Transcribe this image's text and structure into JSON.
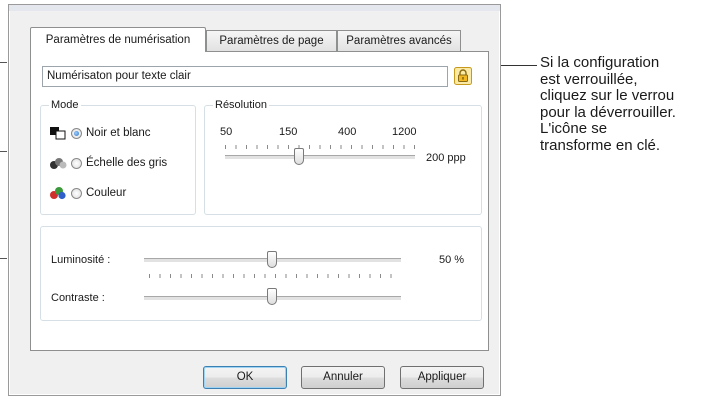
{
  "tabs": [
    {
      "label": "Paramètres de numérisation",
      "active": true
    },
    {
      "label": "Paramètres de page",
      "active": false
    },
    {
      "label": "Paramètres avancés",
      "active": false
    }
  ],
  "configuration": {
    "name_value": "Numérisaton pour texte clair",
    "lock_icon": "lock-icon"
  },
  "mode": {
    "title": "Mode",
    "options": [
      {
        "label": "Noir et blanc",
        "checked": true,
        "icon": "black-white-mode-icon"
      },
      {
        "label": "Échelle des gris",
        "checked": false,
        "icon": "grayscale-mode-icon"
      },
      {
        "label": "Couleur",
        "checked": false,
        "icon": "color-mode-icon"
      }
    ]
  },
  "resolution": {
    "title": "Résolution",
    "ticks": [
      "50",
      "150",
      "400",
      "1200"
    ],
    "value": 200,
    "value_label": "200 ppp"
  },
  "adjustments": {
    "brightness": {
      "label": "Luminosité :",
      "value": 50,
      "value_label": "50 %"
    },
    "contrast": {
      "label": "Contraste :",
      "value": 50
    }
  },
  "buttons": {
    "ok": "OK",
    "cancel": "Annuler",
    "apply": "Appliquer"
  },
  "callout": {
    "lines": [
      "Si la configuration",
      "est verrouillée,",
      "cliquez sur le verrou",
      "pour la déverrouiller.",
      "L'icône se",
      "transforme en clé."
    ]
  },
  "colors": {
    "lock": "#f2b824",
    "radio_checked": "#2a6fc1",
    "default_button_border": "#3c7fb1"
  }
}
